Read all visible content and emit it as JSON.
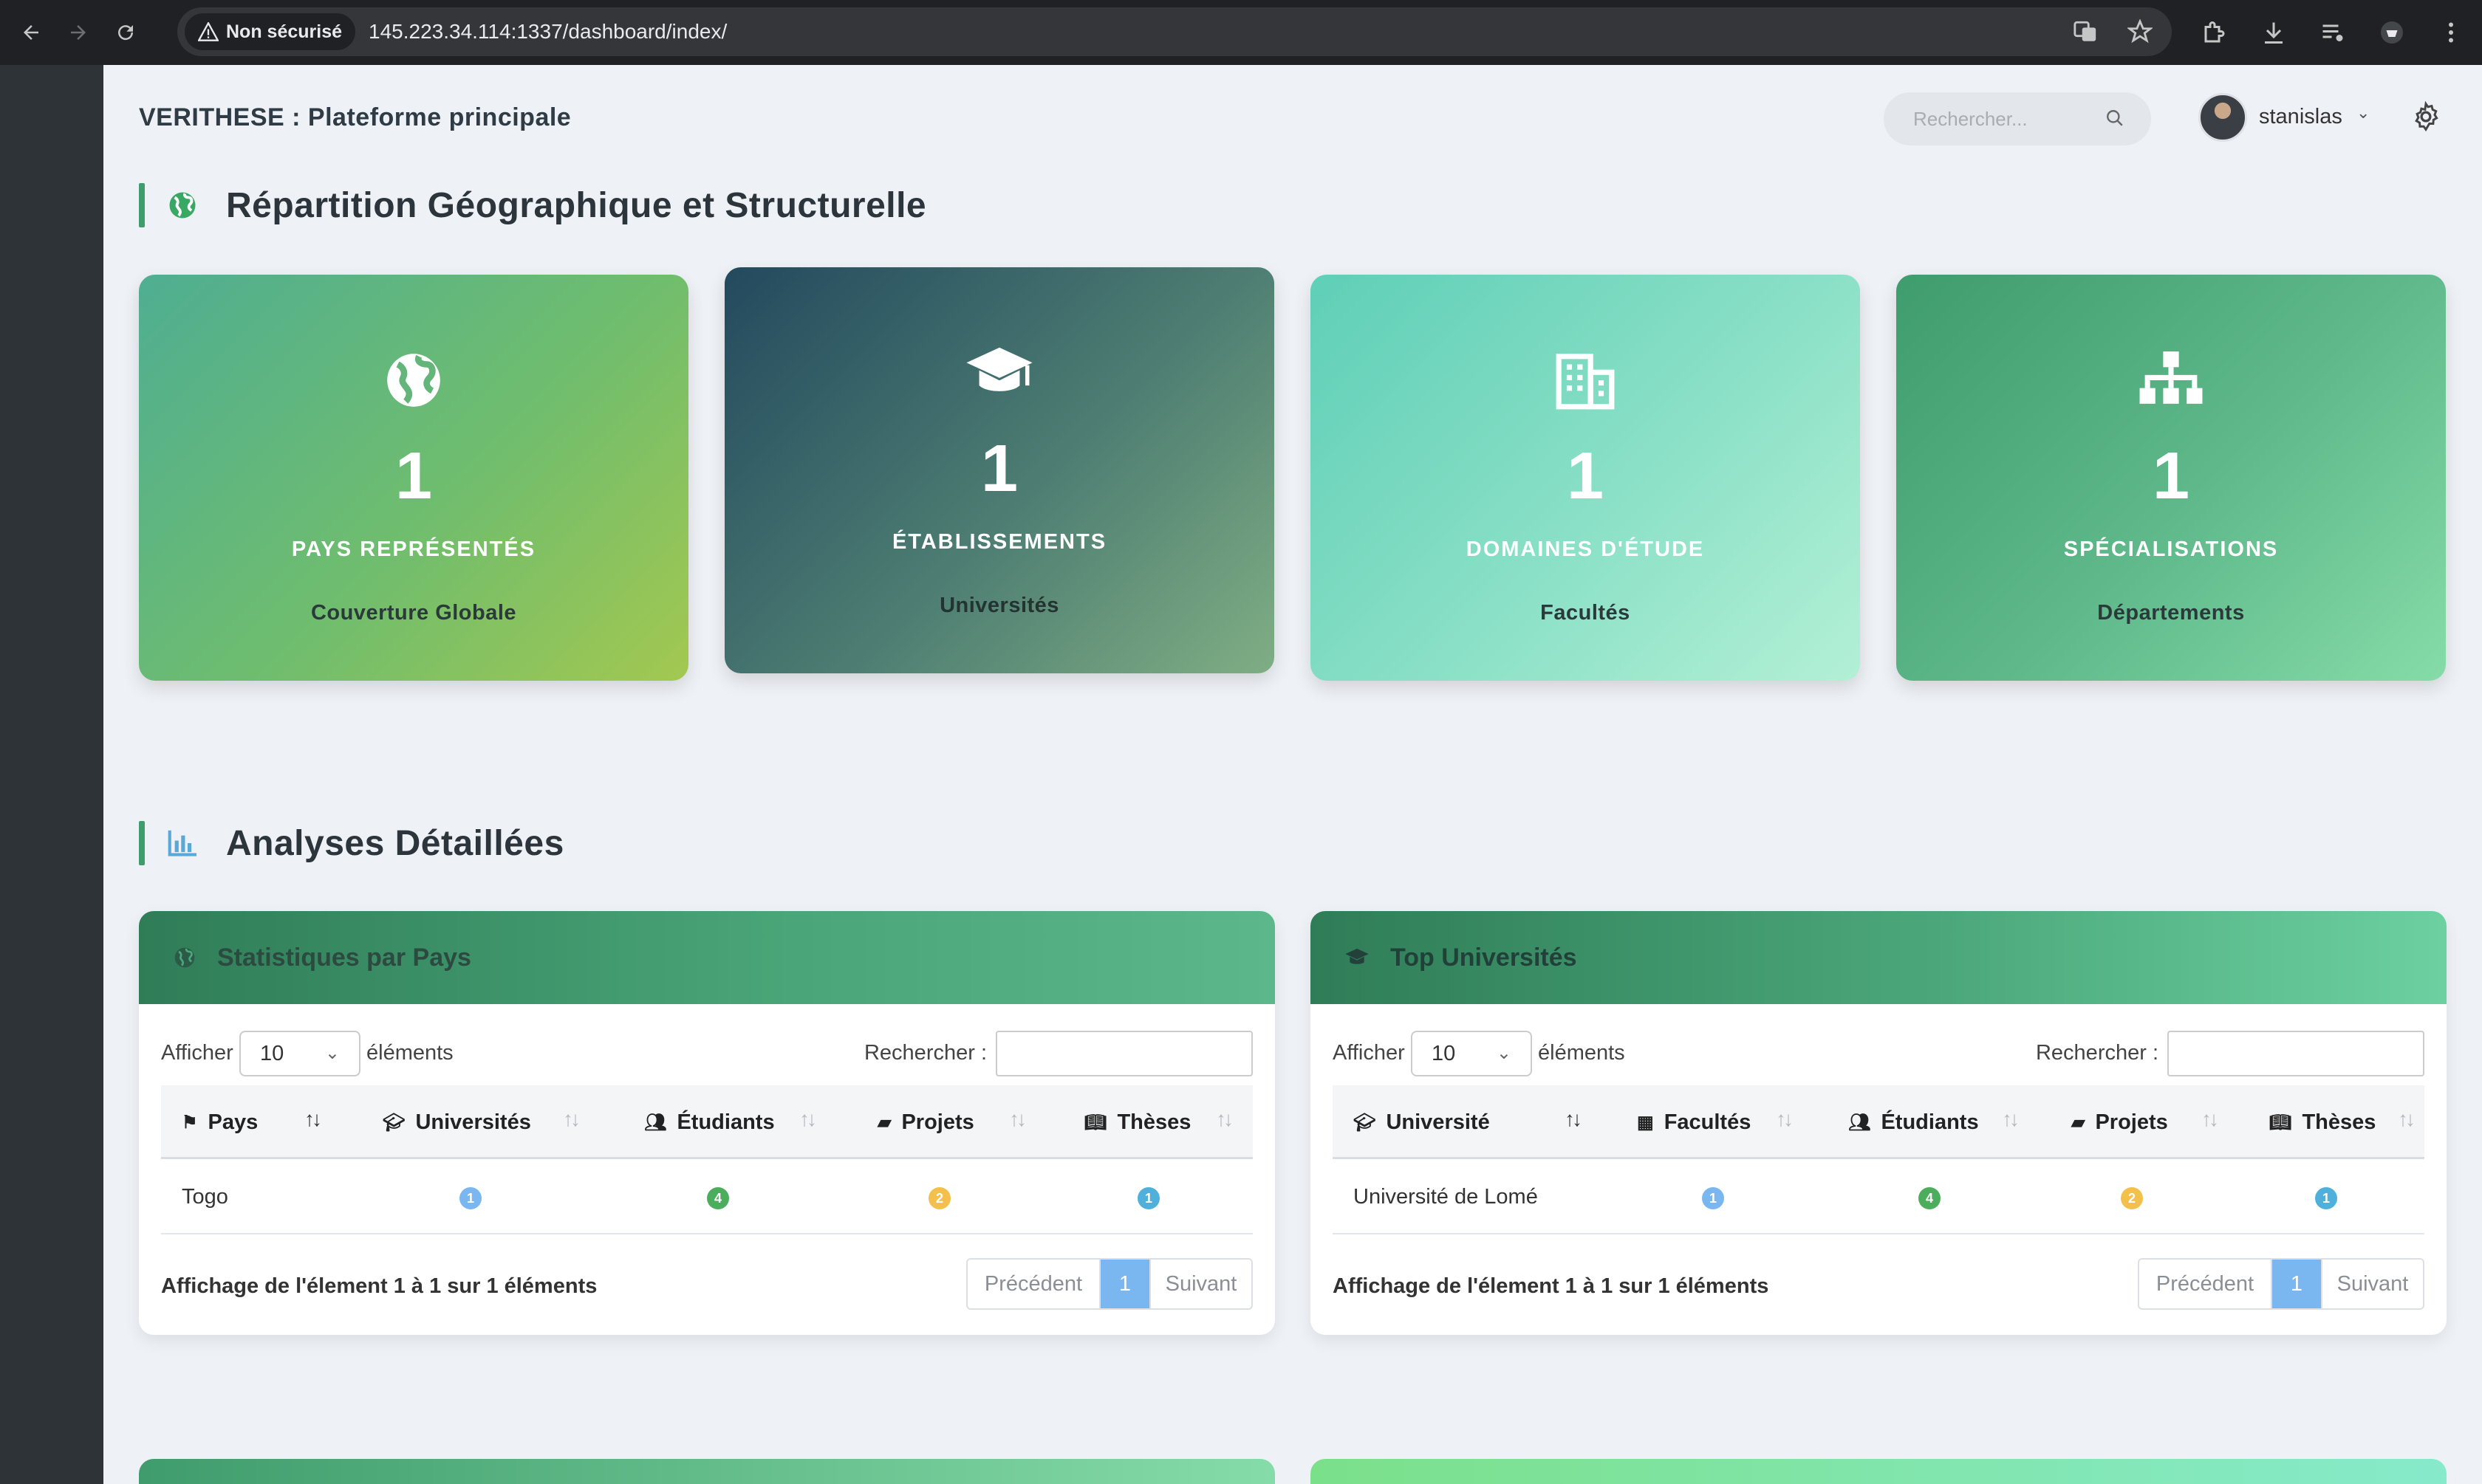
{
  "browser": {
    "security_label": "Non sécurisé",
    "url": "145.223.34.114:1337/dashboard/index/"
  },
  "header": {
    "title": "VERITHESE : Plateforme principale",
    "search_placeholder": "Rechercher...",
    "user_name": "stanislas"
  },
  "sections": {
    "geo_title": "Répartition Géographique et Structurelle",
    "analysis_title": "Analyses Détaillées"
  },
  "cards": [
    {
      "icon": "globe-icon",
      "value": "1",
      "label": "PAYS REPRÉSENTÉS",
      "sublabel": "Couverture Globale"
    },
    {
      "icon": "graduation-cap-icon",
      "value": "1",
      "label": "ÉTABLISSEMENTS",
      "sublabel": "Universités"
    },
    {
      "icon": "building-icon",
      "value": "1",
      "label": "DOMAINES D'ÉTUDE",
      "sublabel": "Facultés"
    },
    {
      "icon": "sitemap-icon",
      "value": "1",
      "label": "SPÉCIALISATIONS",
      "sublabel": "Départements"
    }
  ],
  "panels": [
    {
      "title": "Statistiques par Pays",
      "show_label": "Afficher",
      "page_size": "10",
      "entries_label": "éléments",
      "search_label": "Rechercher :",
      "columns": [
        "Pays",
        "Universités",
        "Étudiants",
        "Projets",
        "Thèses"
      ],
      "rows": [
        {
          "name": "Togo",
          "c1": "1",
          "c2": "4",
          "c3": "2",
          "c4": "1"
        }
      ],
      "info": "Affichage de l'élement 1 à 1 sur 1 éléments",
      "prev": "Précédent",
      "page": "1",
      "next": "Suivant"
    },
    {
      "title": "Top Universités",
      "show_label": "Afficher",
      "page_size": "10",
      "entries_label": "éléments",
      "search_label": "Rechercher :",
      "columns": [
        "Université",
        "Facultés",
        "Étudiants",
        "Projets",
        "Thèses"
      ],
      "rows": [
        {
          "name": "Université de Lomé",
          "c1": "1",
          "c2": "4",
          "c3": "2",
          "c4": "1"
        }
      ],
      "info": "Affichage de l'élement 1 à 1 sur 1 éléments",
      "prev": "Précédent",
      "page": "1",
      "next": "Suivant"
    }
  ],
  "colors": {
    "accent_green": "#3f9c6c",
    "badge_blue": "#7ab6f0",
    "badge_green": "#4cae5c",
    "badge_yellow": "#f3c04b",
    "badge_cyan": "#4fb0dc"
  }
}
